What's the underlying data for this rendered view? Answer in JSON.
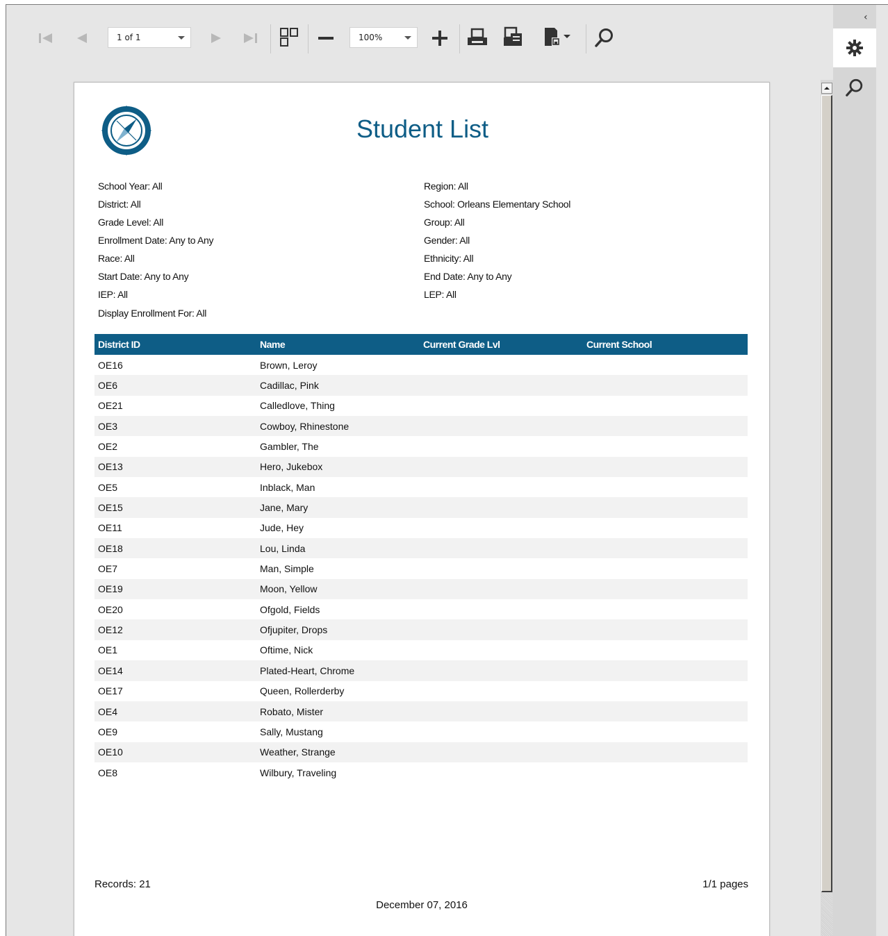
{
  "toolbar": {
    "page_selector_value": "1 of 1",
    "zoom_value": "100%"
  },
  "report": {
    "title": "Student List",
    "params_left": [
      "School Year: All",
      "District: All",
      "Grade Level: All",
      "Enrollment Date: Any to Any",
      "Race: All",
      "Start Date: Any to Any",
      "IEP: All",
      "Display Enrollment For: All"
    ],
    "params_right": [
      "Region: All",
      "School: Orleans Elementary School",
      "Group: All",
      "Gender: All",
      "Ethnicity: All",
      "End Date: Any to Any",
      "LEP: All"
    ],
    "columns": [
      "District ID",
      "Name",
      "Current Grade Lvl",
      "Current School"
    ],
    "rows": [
      [
        "OE16",
        "Brown, Leroy"
      ],
      [
        "OE6",
        "Cadillac, Pink"
      ],
      [
        "OE21",
        "Calledlove, Thing"
      ],
      [
        "OE3",
        "Cowboy, Rhinestone"
      ],
      [
        "OE2",
        "Gambler, The"
      ],
      [
        "OE13",
        "Hero, Jukebox"
      ],
      [
        "OE5",
        "Inblack, Man"
      ],
      [
        "OE15",
        "Jane, Mary"
      ],
      [
        "OE11",
        "Jude, Hey"
      ],
      [
        "OE18",
        "Lou, Linda"
      ],
      [
        "OE7",
        "Man, Simple"
      ],
      [
        "OE19",
        "Moon, Yellow"
      ],
      [
        "OE20",
        "Ofgold, Fields"
      ],
      [
        "OE12",
        "Ofjupiter, Drops"
      ],
      [
        "OE1",
        "Oftime, Nick"
      ],
      [
        "OE14",
        "Plated-Heart, Chrome"
      ],
      [
        "OE17",
        "Queen, Rollerderby"
      ],
      [
        "OE4",
        "Robato, Mister"
      ],
      [
        "OE9",
        "Sally, Mustang"
      ],
      [
        "OE10",
        "Weather, Strange"
      ],
      [
        "OE8",
        "Wilbury, Traveling"
      ]
    ],
    "records_label": "Records:  21",
    "pages_label": "1/1 pages",
    "footer_date": "December 07, 2016"
  },
  "side_panel": {
    "collapse_glyph": "‹",
    "tabs": [
      "gear-icon",
      "search-icon"
    ]
  },
  "colors": {
    "accent": "#0e5d86",
    "toolbar_bg": "#e6e6e6",
    "row_alt": "#f2f2f2"
  }
}
